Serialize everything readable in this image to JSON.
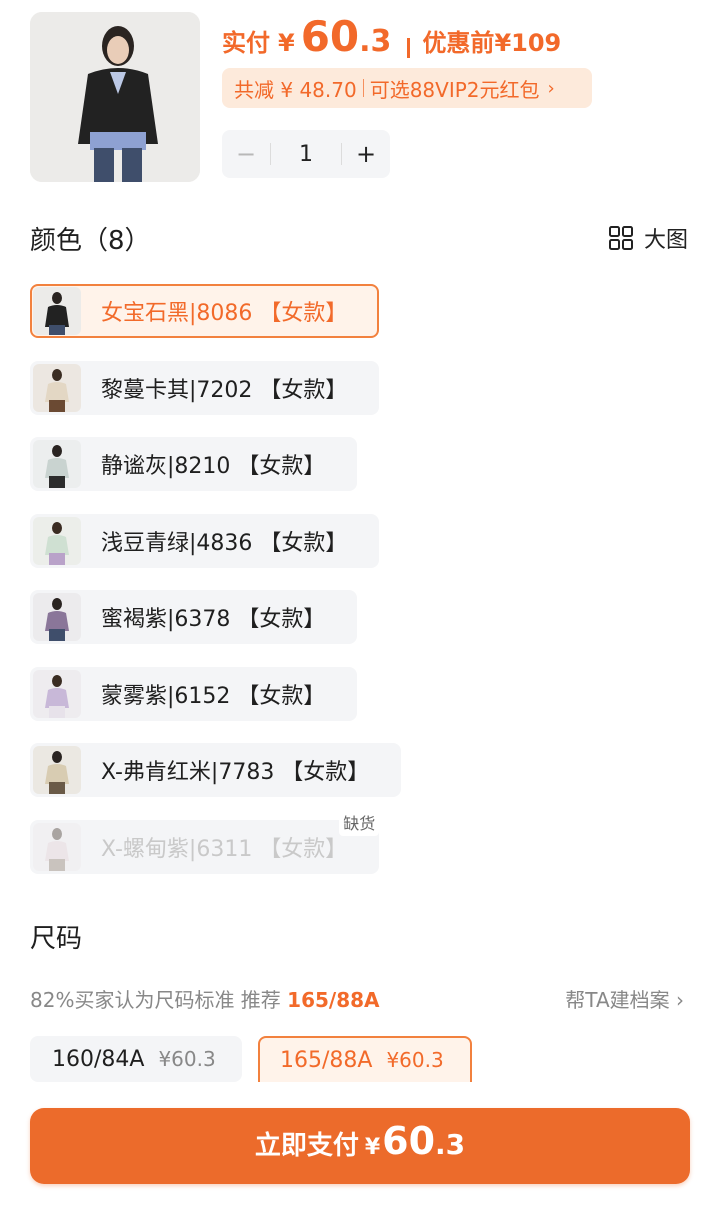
{
  "header": {
    "final_price_label": "实付",
    "currency": "¥",
    "final_price_int": "60",
    "final_price_dec": ".3",
    "orig_price_label": "优惠前",
    "orig_price": "¥109",
    "discount_text": "共减 ¥ 48.70",
    "coupon_text": "可选88VIP2元红包",
    "quantity": "1",
    "minus": "−",
    "plus": "+"
  },
  "colors": {
    "title": "颜色（8）",
    "bigpic_label": "大图",
    "options": [
      {
        "label": "女宝石黑|8086 【女款】",
        "selected": true,
        "disabled": false
      },
      {
        "label": "黎蔓卡其|7202 【女款】",
        "selected": false,
        "disabled": false
      },
      {
        "label": "静谧灰|8210 【女款】",
        "selected": false,
        "disabled": false
      },
      {
        "label": "浅豆青绿|4836 【女款】",
        "selected": false,
        "disabled": false
      },
      {
        "label": "蜜褐紫|6378 【女款】",
        "selected": false,
        "disabled": false
      },
      {
        "label": "蒙雾紫|6152 【女款】",
        "selected": false,
        "disabled": false
      },
      {
        "label": "X-弗肯红米|7783 【女款】",
        "selected": false,
        "disabled": false
      },
      {
        "label": "X-螺甸紫|6311 【女款】",
        "selected": false,
        "disabled": true
      }
    ],
    "out_of_stock_badge": "缺货"
  },
  "size": {
    "title": "尺码",
    "hint_text": "82%买家认为尺码标准 推荐",
    "hint_recommend": "165/88A",
    "profile_link": "帮TA建档案",
    "options": [
      {
        "size": "160/84A",
        "price": "¥60.3"
      },
      {
        "size": "165/88A",
        "price": "¥60.3"
      }
    ]
  },
  "pay_button": {
    "label": "立即支付",
    "currency": "¥",
    "amount_int": "60",
    "amount_dec": ".3"
  },
  "colors_palette": {
    "accent": "#ec6b2b",
    "accent_light_bg": "#fdeadb",
    "chip_bg": "#f4f5f7"
  },
  "icons": [
    "grid-icon",
    "chevron-right-icon"
  ]
}
